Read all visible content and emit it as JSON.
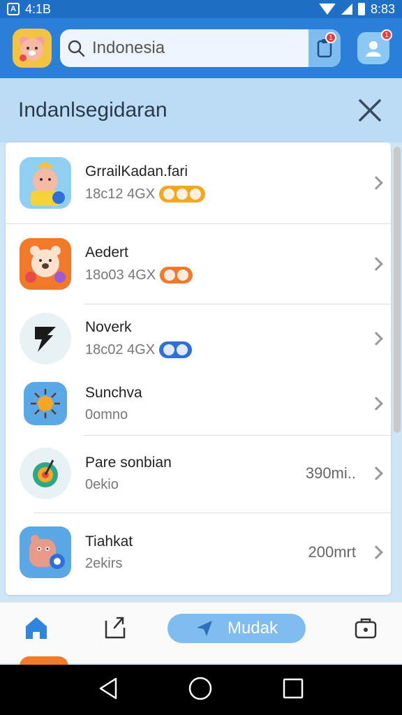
{
  "status_bar": {
    "left_text": "4:1B",
    "time": "8:83"
  },
  "header": {
    "search_placeholder": "Search",
    "search_value": "Indonesia",
    "clip_badge": "1",
    "profile_badge": "1"
  },
  "sheet": {
    "title": "Indanlsegidaran"
  },
  "apps": [
    {
      "title": "GrrailKadan.fari",
      "subtitle": "18c12 4GX",
      "pill_color": "#f5a623",
      "icon_color": "#8fd0f2",
      "right": ""
    },
    {
      "title": "Aedert",
      "subtitle": "18o03 4GX",
      "pill_color": "#f07a2a",
      "icon_color": "#f07a2a",
      "right": ""
    },
    {
      "title": "Noverk",
      "subtitle": "18c02 4GX",
      "pill_color": "#2e6fd8",
      "icon_color": "#e8f2f4",
      "right": ""
    },
    {
      "title": "Sunchva",
      "subtitle": "0omno",
      "pill_color": "",
      "icon_color": "#5aa8e6",
      "right": ""
    },
    {
      "title": "Pare sonbian",
      "subtitle": "0ekio",
      "pill_color": "",
      "icon_color": "#e8f2f4",
      "right": "390mi.."
    },
    {
      "title": "Tiahkat",
      "subtitle": "2ekirs",
      "pill_color": "",
      "icon_color": "#5aa8e6",
      "right": "200mrt"
    }
  ],
  "bottom_nav": {
    "primary_label": "Mudak"
  },
  "colors": {
    "primary": "#2a80d8",
    "accent": "#7fbcf0"
  }
}
